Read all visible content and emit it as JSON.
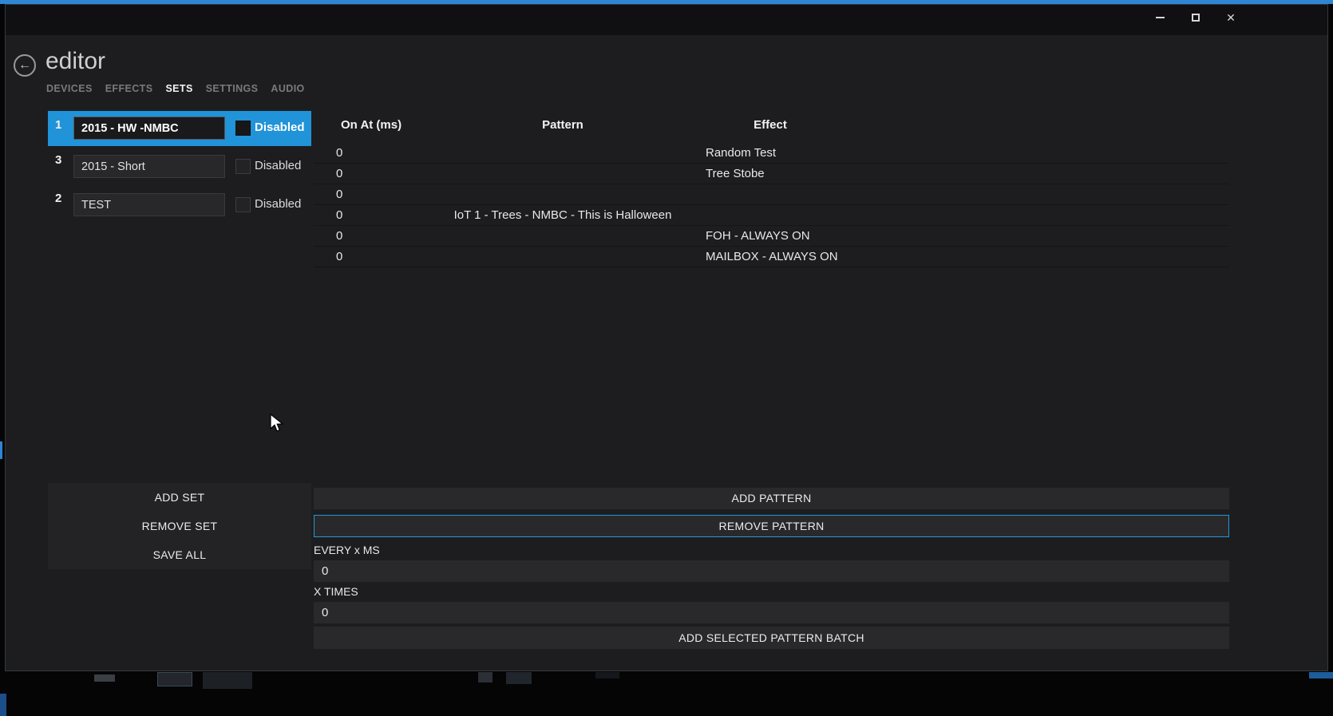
{
  "window": {
    "title": "editor"
  },
  "icons": {
    "back": "←",
    "close": "✕"
  },
  "tabs": [
    {
      "label": "DEVICES",
      "active": false
    },
    {
      "label": "EFFECTS",
      "active": false
    },
    {
      "label": "SETS",
      "active": true
    },
    {
      "label": "SETTINGS",
      "active": false
    },
    {
      "label": "AUDIO",
      "active": false
    }
  ],
  "sets": [
    {
      "order": "1",
      "name": "2015 - HW -NMBC",
      "disabled_label": "Disabled",
      "selected": true
    },
    {
      "order": "3",
      "name": "2015 - Short",
      "disabled_label": "Disabled",
      "selected": false
    },
    {
      "order": "2",
      "name": "TEST",
      "disabled_label": "Disabled",
      "selected": false
    }
  ],
  "table": {
    "columns": [
      "On At (ms)",
      "Pattern",
      "Effect"
    ],
    "rows": [
      {
        "on_at": "0",
        "pattern": "",
        "effect": "Random Test"
      },
      {
        "on_at": "0",
        "pattern": "",
        "effect": "Tree Stobe"
      },
      {
        "on_at": "0",
        "pattern": "",
        "effect": ""
      },
      {
        "on_at": "0",
        "pattern": "IoT 1 - Trees - NMBC - This is Halloween",
        "effect": ""
      },
      {
        "on_at": "0",
        "pattern": "",
        "effect": "FOH - ALWAYS ON"
      },
      {
        "on_at": "0",
        "pattern": "",
        "effect": "MAILBOX - ALWAYS ON"
      }
    ]
  },
  "set_actions": {
    "add": "ADD SET",
    "remove": "REMOVE SET",
    "save": "SAVE ALL"
  },
  "pattern_controls": {
    "add": "ADD PATTERN",
    "remove": "REMOVE PATTERN",
    "every_label": "EVERY x MS",
    "every_value": "0",
    "times_label": "X TIMES",
    "times_value": "0",
    "batch": "ADD SELECTED PATTERN BATCH"
  },
  "colors": {
    "accent": "#2193d8",
    "top_border": "#2f87d4"
  }
}
